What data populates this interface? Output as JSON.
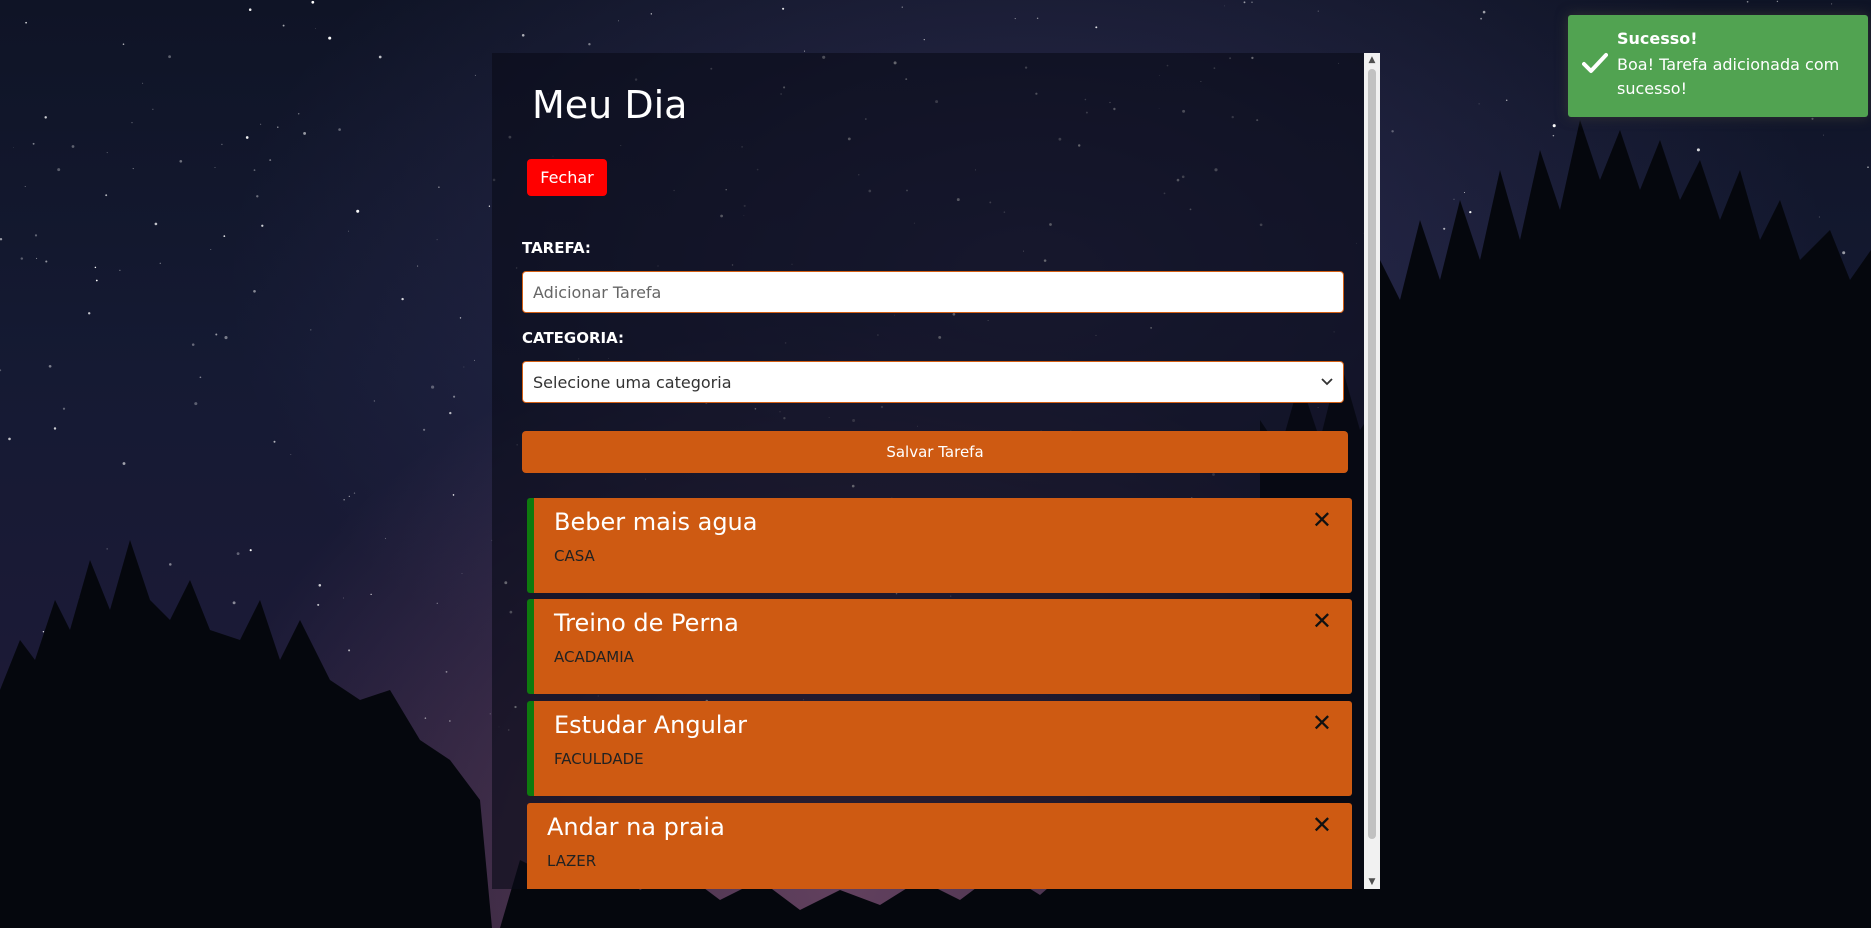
{
  "app": {
    "title": "Meu Dia"
  },
  "header": {
    "close_label": "Fechar"
  },
  "form": {
    "task_label": "TAREFA:",
    "task_placeholder": "Adicionar Tarefa",
    "task_value": "",
    "category_label": "CATEGORIA:",
    "category_selected": "Selecione uma categoria",
    "save_label": "Salvar Tarefa"
  },
  "tasks": [
    {
      "title": "Beber mais agua",
      "category": "CASA",
      "completed": true
    },
    {
      "title": "Treino de Perna",
      "category": "ACADAMIA",
      "completed": true
    },
    {
      "title": "Estudar Angular",
      "category": "FACULDADE",
      "completed": true
    },
    {
      "title": "Andar na praia",
      "category": "LAZER",
      "completed": false
    }
  ],
  "toast": {
    "title": "Sucesso!",
    "message": "Boa! Tarefa adicionada com sucesso!",
    "color": "#51a351"
  },
  "colors": {
    "accent": "#ce5a12",
    "danger": "#ff0000",
    "done_marker": "#0e7a0e"
  },
  "icons": {
    "task_delete": "close-icon",
    "toast": "checkmark-icon",
    "select": "chevron-down-icon"
  }
}
